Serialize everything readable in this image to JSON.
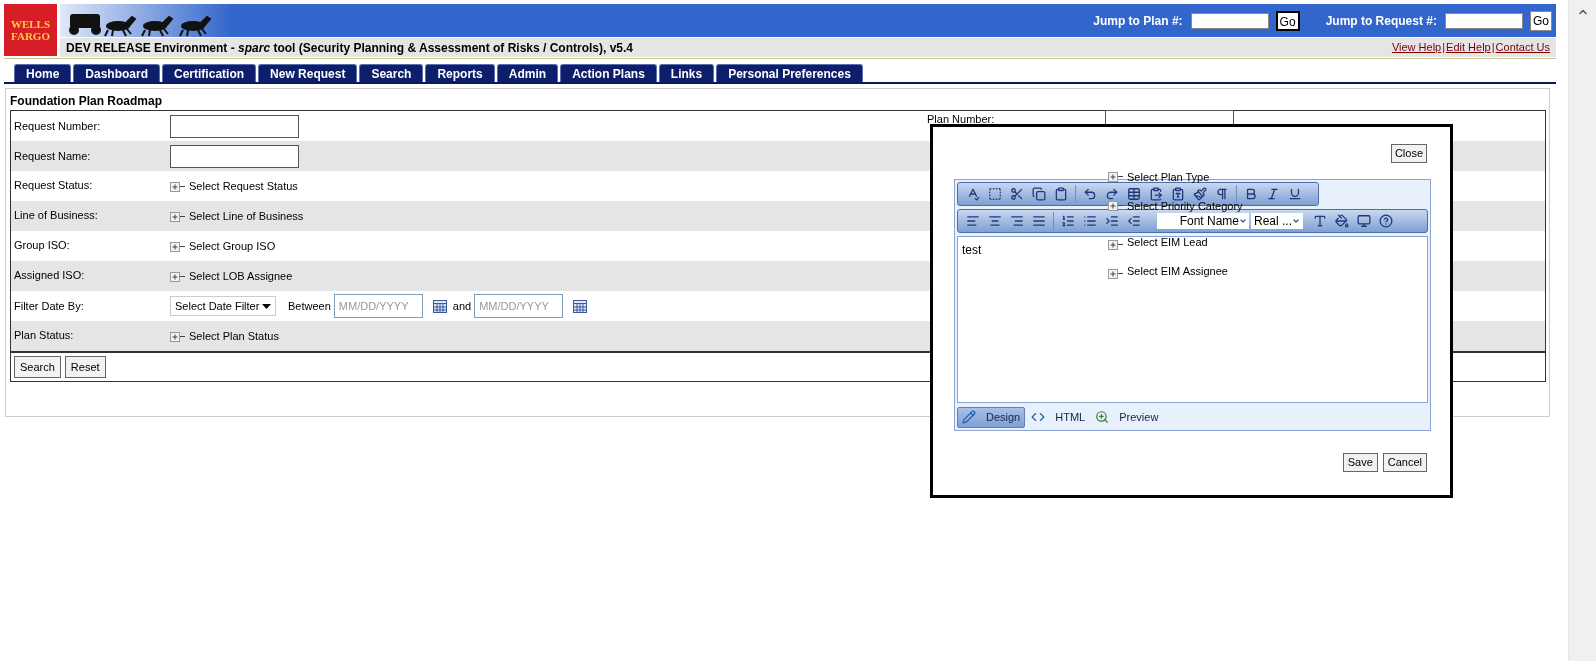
{
  "header": {
    "logo": "WELLS FARGO",
    "jump_fields": [
      {
        "label": "Jump to Plan #:",
        "button": "Go"
      },
      {
        "label": "Jump to Request #:",
        "button": "Go"
      }
    ],
    "title": "DEV RELEASE Environment - *sparc* tool (Security Planning & Assessment of Risks / Controls), v5.4",
    "help_links": [
      {
        "label": "View Help",
        "separator": "|"
      },
      {
        "label": "Edit Help",
        "separator": "|"
      },
      {
        "label": "Contact Us"
      }
    ]
  },
  "tabs": [
    {
      "label": "Home"
    },
    {
      "label": "Dashboard"
    },
    {
      "label": "Certification"
    },
    {
      "label": "New Request"
    },
    {
      "label": "Search"
    },
    {
      "label": "Reports"
    },
    {
      "label": "Admin"
    },
    {
      "label": "Action Plans"
    },
    {
      "label": "Links"
    },
    {
      "label": "Personal Preferences"
    }
  ],
  "panel": {
    "title": "Foundation Plan Roadmap",
    "rows": [
      {
        "kind": "text",
        "label": "Request Number:",
        "right_label": "Plan Number:"
      },
      {
        "kind": "text",
        "label": "Request Name:"
      },
      {
        "kind": "tree",
        "label": "Request Status:",
        "value": "Select Request Status"
      },
      {
        "kind": "tree",
        "label": "Line of Business:",
        "value": "Select Line of Business"
      },
      {
        "kind": "tree",
        "label": "Group ISO:",
        "value": "Select Group ISO"
      },
      {
        "kind": "tree",
        "label": "Assigned ISO:",
        "value": "Select LOB Assignee"
      },
      {
        "kind": "date",
        "label": "Filter Date By:",
        "select": "Select Date Filter",
        "between": "Between",
        "and": "and",
        "from_placeholder": "MM/DD/YYYY",
        "to_placeholder": "MM/DD/YYYY"
      },
      {
        "kind": "tree",
        "label": "Plan Status:",
        "value": "Select Plan Status"
      }
    ],
    "buttons": [
      "Search",
      "Reset"
    ]
  },
  "overlay_options": [
    "Select Plan Type",
    "Select Priority Category",
    "Select EIM Lead",
    "Select EIM Assignee"
  ],
  "dialog": {
    "close": "Close",
    "editor_text": "test",
    "font_name": "Font Name",
    "font_size": "Real ...",
    "modes": [
      {
        "label": "Design",
        "selected": true
      },
      {
        "label": "HTML",
        "selected": false
      },
      {
        "label": "Preview",
        "selected": false
      }
    ],
    "buttons": [
      "Save",
      "Cancel"
    ]
  }
}
